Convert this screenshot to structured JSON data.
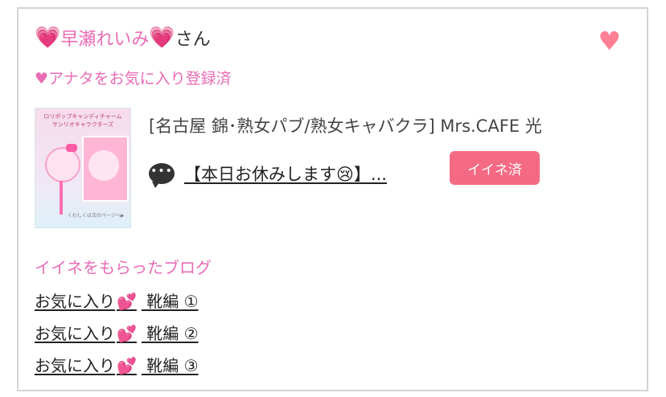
{
  "header": {
    "name": "早瀬れいみ",
    "suffix": "さん",
    "heart_left": "💗",
    "heart_right": "💗",
    "favorite_icon": "♥"
  },
  "registered": "♥アナタをお気に入り登録済",
  "thumbnail": {
    "title": "ロリポップキャンディチャーム サンリオキャラクターズ",
    "footer": "くわしくは次のページへ▶"
  },
  "shop": {
    "label": "[名古屋 錦･熟女パブ/熟女キャバクラ]  Mrs.CAFE 光"
  },
  "latest_post": {
    "icon": "speech-bubble",
    "dots": "•••",
    "title": "【本日お休みします😢】..."
  },
  "like_badge": "イイネ済",
  "liked_blogs": {
    "heading": "イイネをもらったブログ",
    "items": [
      {
        "prefix": "お気に入り",
        "emoji": "💕",
        "suffix": " 靴編 ①"
      },
      {
        "prefix": "お気に入り",
        "emoji": "💕",
        "suffix": " 靴編 ②"
      },
      {
        "prefix": "お気に入り",
        "emoji": "💕",
        "suffix": " 靴編 ③"
      }
    ]
  },
  "colors": {
    "accent_pink": "#e96cb5",
    "badge": "#f46a83",
    "favorite_heart": "#ff7f94",
    "border": "#d4d4d4"
  }
}
